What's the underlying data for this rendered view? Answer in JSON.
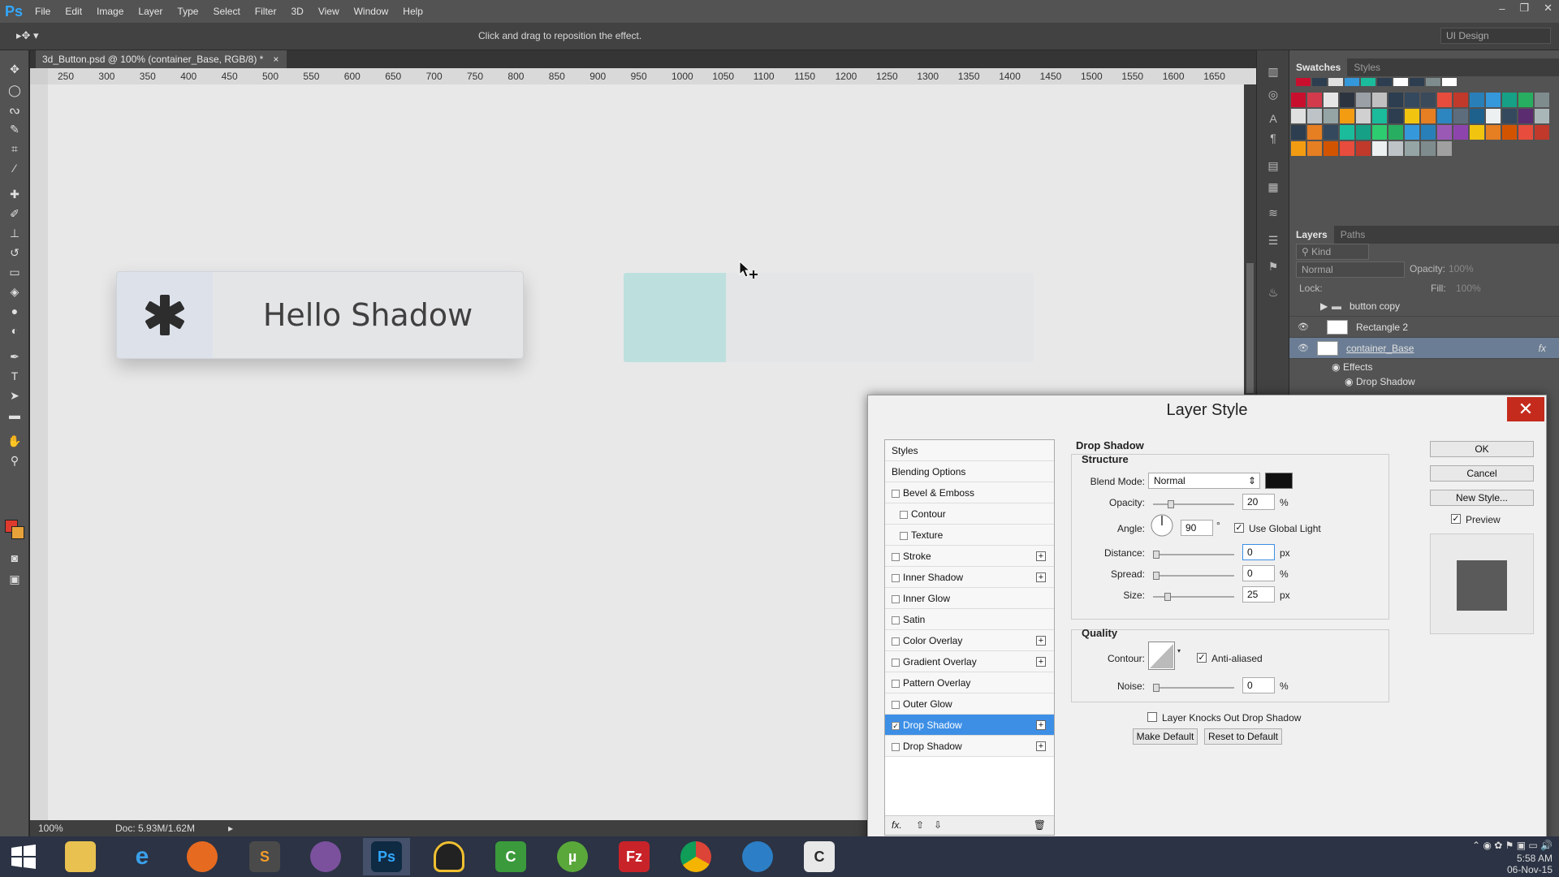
{
  "app": {
    "logo": "Ps",
    "menu": [
      "File",
      "Edit",
      "Image",
      "Layer",
      "Type",
      "Select",
      "Filter",
      "3D",
      "View",
      "Window",
      "Help"
    ]
  },
  "optionsbar": {
    "hint": "Click and drag to reposition the effect.",
    "workspace": "UI Design"
  },
  "document": {
    "tab_title": "3d_Button.psd @ 100% (container_Base, RGB/8) *",
    "tab_close": "×",
    "zoom": "100%",
    "doc_info": "Doc: 5.93M/1.62M",
    "ruler_ticks": [
      "250",
      "300",
      "350",
      "400",
      "450",
      "500",
      "550",
      "600",
      "650",
      "700",
      "750",
      "800",
      "850",
      "900",
      "950",
      "1000",
      "1050",
      "1100",
      "1150",
      "1200",
      "1250",
      "1300",
      "1350",
      "1400",
      "1450",
      "1500",
      "1550",
      "1600",
      "1650"
    ]
  },
  "canvas": {
    "button1_label": "Hello Shadow",
    "button1_icon": "asterisk-icon",
    "accent_color": "#bde0de"
  },
  "panels": {
    "swatches_tab": "Swatches",
    "styles_tab": "Styles",
    "layers_tab": "Layers",
    "paths_tab": "Paths",
    "kind_filter": "Kind",
    "blend_mode": "Normal",
    "opacity_label": "Opacity:",
    "opacity_value": "100%",
    "lock_label": "Lock:",
    "fill_label": "Fill:",
    "fill_value": "100%",
    "layers": [
      {
        "name": "button copy"
      },
      {
        "name": "Rectangle 2"
      },
      {
        "name": "container_Base"
      }
    ],
    "effects_label": "Effects",
    "effect_name": "Drop Shadow"
  },
  "dialog": {
    "title": "Layer Style",
    "styles_header": "Styles",
    "items": [
      {
        "label": "Blending Options",
        "checkbox": false,
        "plus": false,
        "checked": false
      },
      {
        "label": "Bevel & Emboss",
        "checkbox": true,
        "plus": false,
        "checked": false
      },
      {
        "label": "Contour",
        "checkbox": true,
        "plus": false,
        "checked": false,
        "indent": true
      },
      {
        "label": "Texture",
        "checkbox": true,
        "plus": false,
        "checked": false,
        "indent": true
      },
      {
        "label": "Stroke",
        "checkbox": true,
        "plus": true,
        "checked": false
      },
      {
        "label": "Inner Shadow",
        "checkbox": true,
        "plus": true,
        "checked": false
      },
      {
        "label": "Inner Glow",
        "checkbox": true,
        "plus": false,
        "checked": false
      },
      {
        "label": "Satin",
        "checkbox": true,
        "plus": false,
        "checked": false
      },
      {
        "label": "Color Overlay",
        "checkbox": true,
        "plus": true,
        "checked": false
      },
      {
        "label": "Gradient Overlay",
        "checkbox": true,
        "plus": true,
        "checked": false
      },
      {
        "label": "Pattern Overlay",
        "checkbox": true,
        "plus": false,
        "checked": false
      },
      {
        "label": "Outer Glow",
        "checkbox": true,
        "plus": false,
        "checked": false
      },
      {
        "label": "Drop Shadow",
        "checkbox": true,
        "plus": true,
        "checked": true,
        "selected": true
      },
      {
        "label": "Drop Shadow",
        "checkbox": true,
        "plus": true,
        "checked": false
      }
    ],
    "section_title": "Drop Shadow",
    "structure_title": "Structure",
    "blend_mode_label": "Blend Mode:",
    "blend_mode_value": "Normal",
    "shadow_color": "#111111",
    "opacity_label": "Opacity:",
    "opacity_value": "20",
    "angle_label": "Angle:",
    "angle_value": "90",
    "degree_symbol": "°",
    "use_global_light": "Use Global Light",
    "distance_label": "Distance:",
    "distance_value": "0",
    "spread_label": "Spread:",
    "spread_value": "0",
    "size_label": "Size:",
    "size_value": "25",
    "unit_px": "px",
    "unit_pct": "%",
    "quality_title": "Quality",
    "contour_label": "Contour:",
    "anti_aliased": "Anti-aliased",
    "noise_label": "Noise:",
    "noise_value": "0",
    "layer_knocks_out": "Layer Knocks Out Drop Shadow",
    "make_default": "Make Default",
    "reset_default": "Reset to Default",
    "ok": "OK",
    "cancel": "Cancel",
    "new_style": "New Style...",
    "preview": "Preview",
    "close_glyph": "✕",
    "footer_fx": "fx."
  },
  "taskbar": {
    "clock": "5:58 AM",
    "date": "06-Nov-15",
    "ps_label": "Ps",
    "sublime_label": "S",
    "filezilla_label": "Fz"
  }
}
